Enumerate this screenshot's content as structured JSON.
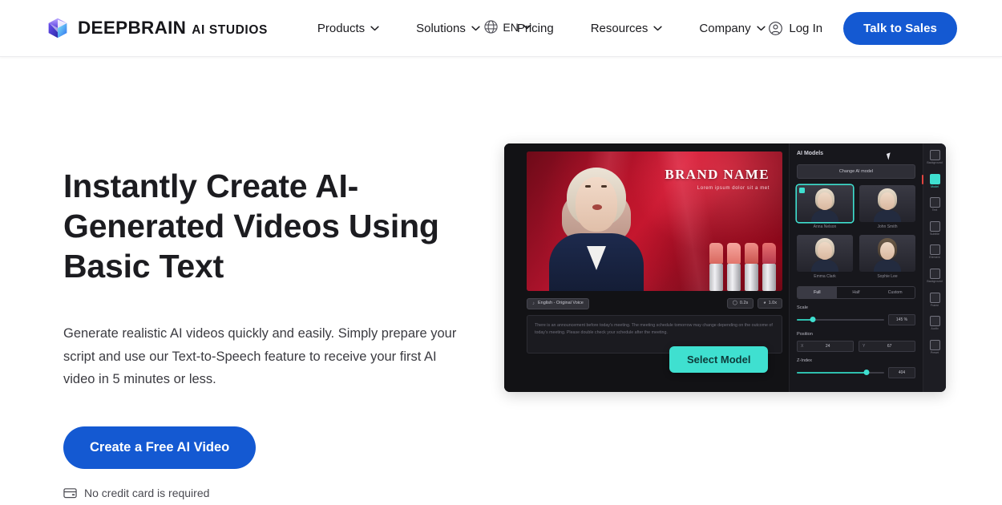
{
  "header": {
    "logo_icon": "cube-logo-icon",
    "brand_name": "DEEPBRAIN",
    "brand_sub": "AI STUDIOS",
    "nav": [
      {
        "label": "Products",
        "has_caret": true
      },
      {
        "label": "Solutions",
        "has_caret": true
      },
      {
        "label": "Pricing",
        "has_caret": false
      },
      {
        "label": "Resources",
        "has_caret": true
      },
      {
        "label": "Company",
        "has_caret": true
      }
    ],
    "language": {
      "icon": "globe-icon",
      "label": "EN"
    },
    "login": {
      "icon": "user-circle-icon",
      "label": "Log In"
    },
    "cta": "Talk to Sales",
    "accent_blue": "#1459d2"
  },
  "hero": {
    "headline": "Instantly Create AI-Generated Videos Using Basic Text",
    "subhead": "Generate realistic AI videos quickly and easily. Simply prepare your script and use our Text-to-Speech feature to receive your first AI video in 5 minutes or less.",
    "cta": "Create a Free AI Video",
    "note_icon": "credit-card-icon",
    "note": "No credit card is required"
  },
  "preview": {
    "canvas": {
      "brand_name": "BRAND NAME",
      "brand_tagline": "Lorem ipsum dolor sit a met",
      "voice_chip": "English - Original Voice",
      "voice_chip_icon": "microphone-icon",
      "duration_pill": "0.2s",
      "speed_pill": "1.0x",
      "duration_icon": "clock-icon",
      "speed_icon": "gauge-icon",
      "script": "There is an announcement before today's meeting. The meeting schedule tomorrow may change depending on the outcome of today's meeting. Please double check your schedule after the meeting.",
      "select_model_button": "Select Model"
    },
    "panel": {
      "title": "AI Models",
      "change_button": "Change AI model",
      "models": [
        {
          "label": "Anna Nelson",
          "selected": true
        },
        {
          "label": "John Smith",
          "selected": false
        },
        {
          "label": "Emma Clark",
          "selected": false
        },
        {
          "label": "Sophie Lee",
          "selected": false
        }
      ],
      "segments": [
        {
          "label": "Full",
          "active": true
        },
        {
          "label": "Half",
          "active": false
        },
        {
          "label": "Custom",
          "active": false
        }
      ],
      "scale": {
        "label": "Scale",
        "value": "145 %",
        "percent": 18
      },
      "position": {
        "label": "Position",
        "x_key": "X",
        "x_value": "24",
        "y_key": "Y",
        "y_value": "67"
      },
      "zindex": {
        "label": "Z-Index",
        "value": "404",
        "percent": 80
      }
    },
    "rail": [
      {
        "label": "Background",
        "icon": "background-icon",
        "active": false
      },
      {
        "label": "Model",
        "icon": "person-icon",
        "active": true
      },
      {
        "label": "Text",
        "icon": "text-icon",
        "active": false
      },
      {
        "label": "Subtitle",
        "icon": "subtitle-icon",
        "active": false
      },
      {
        "label": "Element",
        "icon": "shapes-icon",
        "active": false
      },
      {
        "label": "Background",
        "icon": "image-icon",
        "active": false
      },
      {
        "label": "Frame",
        "icon": "frame-icon",
        "active": false
      },
      {
        "label": "Audio",
        "icon": "audio-icon",
        "active": false
      },
      {
        "label": "Preset",
        "icon": "preset-icon",
        "active": false
      }
    ],
    "accent_teal": "#3fe0d0"
  }
}
